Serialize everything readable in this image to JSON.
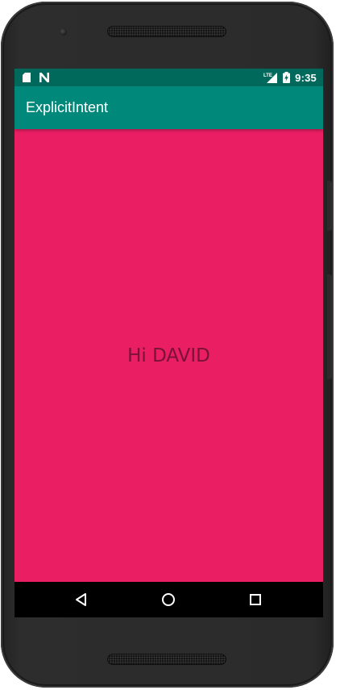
{
  "device": {
    "frame_color": "#2b2b2b"
  },
  "status_bar": {
    "time": "9:35",
    "network_label": "LTE",
    "background": "#00695C",
    "left_icons": [
      "sd-card-icon",
      "n-notification-icon"
    ],
    "right_icons": [
      "lte-signal-icon",
      "battery-charging-icon"
    ]
  },
  "app_bar": {
    "title": "ExplicitIntent",
    "background": "#00897B"
  },
  "main": {
    "background": "#E91E63",
    "message": "Hi DAVID",
    "message_color": "#7a1238"
  },
  "nav_bar": {
    "background": "#000000",
    "buttons": [
      "back-icon",
      "home-icon",
      "recents-icon"
    ]
  }
}
